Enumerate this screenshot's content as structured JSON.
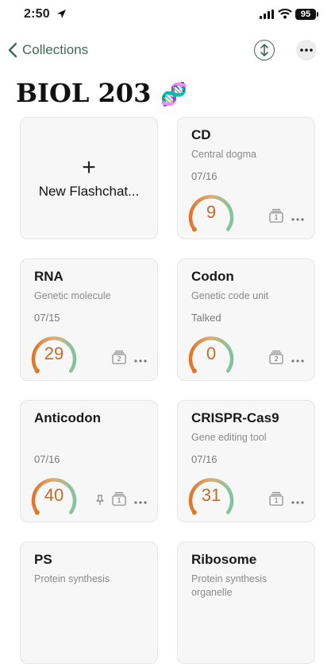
{
  "status_bar": {
    "time": "2:50",
    "battery": "95"
  },
  "nav": {
    "back_label": "Collections"
  },
  "page": {
    "title": "BIOL 203",
    "title_emoji": "🧬"
  },
  "new_card": {
    "plus": "+",
    "label": "New Flashchat..."
  },
  "colors": {
    "accent": "#3b6b53",
    "gauge_orange": "#e0762a",
    "gauge_green": "#7fc4a0"
  },
  "cards": [
    {
      "title": "CD",
      "subtitle": "Central dogma",
      "date": "07/16",
      "score": "9",
      "deck_count": "1",
      "pinned": false
    },
    {
      "title": "RNA",
      "subtitle": "Genetic molecule",
      "date": "07/15",
      "score": "29",
      "deck_count": "2",
      "pinned": false
    },
    {
      "title": "Codon",
      "subtitle": "Genetic code unit",
      "date": "Talked",
      "score": "0",
      "deck_count": "2",
      "pinned": false
    },
    {
      "title": "Anticodon",
      "subtitle": "",
      "date": "07/16",
      "score": "40",
      "deck_count": "1",
      "pinned": true
    },
    {
      "title": "CRISPR-Cas9",
      "subtitle": "Gene editing tool",
      "date": "07/16",
      "score": "31",
      "deck_count": "1",
      "pinned": false
    },
    {
      "title": "PS",
      "subtitle": "Protein synthesis",
      "date": "",
      "score": "",
      "deck_count": "",
      "pinned": false
    },
    {
      "title": "Ribosome",
      "subtitle": "Protein synthesis organelle",
      "date": "",
      "score": "",
      "deck_count": "",
      "pinned": false
    }
  ]
}
